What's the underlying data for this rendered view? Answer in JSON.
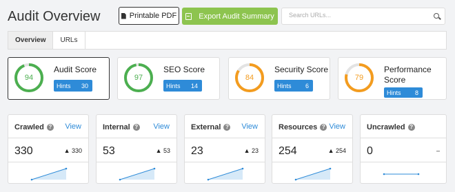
{
  "header": {
    "title": "Audit Overview",
    "pdf_label": "Printable PDF",
    "export_label": "Export Audit Summary",
    "search_placeholder": "Search URLs..."
  },
  "tabs": [
    {
      "label": "Overview",
      "active": true
    },
    {
      "label": "URLs",
      "active": false
    }
  ],
  "scores": [
    {
      "label": "Audit Score",
      "value": "94",
      "percent": 94,
      "hints_label": "Hints",
      "hints": "30",
      "color": "#4caf50",
      "selected": true
    },
    {
      "label": "SEO Score",
      "value": "97",
      "percent": 97,
      "hints_label": "Hints",
      "hints": "14",
      "color": "#4caf50",
      "selected": false
    },
    {
      "label": "Security Score",
      "value": "84",
      "percent": 84,
      "hints_label": "Hints",
      "hints": "6",
      "color": "#f39c1f",
      "selected": false
    },
    {
      "label": "Performance Score",
      "value": "79",
      "percent": 79,
      "hints_label": "Hints",
      "hints": "8",
      "color": "#f39c1f",
      "selected": false
    }
  ],
  "stats": [
    {
      "name": "Crawled",
      "view": "View",
      "value": "330",
      "delta": "▲ 330",
      "trend": "up"
    },
    {
      "name": "Internal",
      "view": "View",
      "value": "53",
      "delta": "▲ 53",
      "trend": "up"
    },
    {
      "name": "External",
      "view": "View",
      "value": "23",
      "delta": "▲ 23",
      "trend": "up"
    },
    {
      "name": "Resources",
      "view": "View",
      "value": "254",
      "delta": "▲ 254",
      "trend": "up"
    },
    {
      "name": "Uncrawled",
      "view": "",
      "value": "0",
      "delta": "–",
      "trend": "flat"
    }
  ],
  "colors": {
    "accent_blue": "#2e8bd8",
    "export_green": "#8dc44f",
    "good_green": "#4caf50",
    "warn_orange": "#f39c1f"
  }
}
